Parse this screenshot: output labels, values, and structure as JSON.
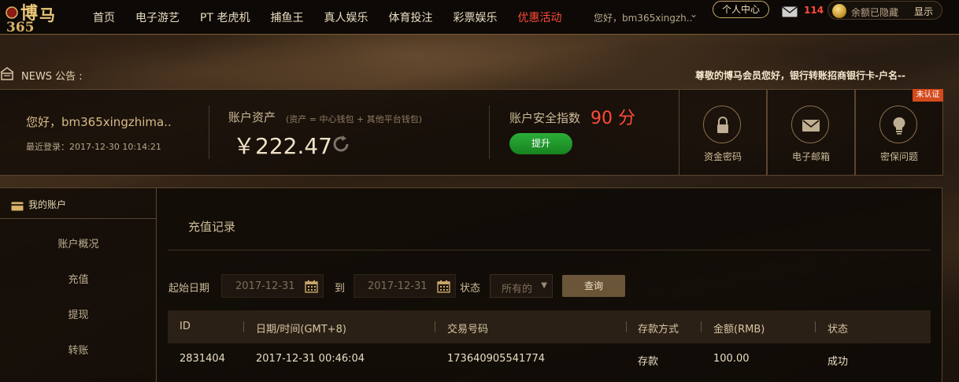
{
  "nav": {
    "items": [
      "首页",
      "电子游艺",
      "PT 老虎机",
      "捕鱼王",
      "真人娱乐",
      "体育投注",
      "彩票娱乐",
      "优惠活动"
    ],
    "highlight_index": 7,
    "greeting": "您好，bm365xingzh..",
    "user_center": "个人中心",
    "mail_count": "114",
    "balance_hidden": "余额已隐藏",
    "show": "显示"
  },
  "news": {
    "label": "NEWS 公告 :",
    "text": "尊敬的博马会员您好，银行转账招商银行卡-户名--"
  },
  "account": {
    "hello": "您好，bm365xingzhima..",
    "last_login": "最近登录：2017-12-30 10:14:21",
    "assets_label": "账户资产",
    "assets_note": "(资产 = 中心钱包 + 其他平台钱包)",
    "amount": "￥222.47",
    "security_label": "账户安全指数",
    "security_score": "90 分",
    "upgrade": "提升"
  },
  "security_tiles": [
    {
      "label": "资金密码",
      "icon": "lock-icon"
    },
    {
      "label": "电子邮箱",
      "icon": "envelope-icon"
    },
    {
      "label": "密保问题",
      "icon": "lightbulb-icon"
    }
  ],
  "badge": "未认证",
  "sidebar": {
    "title": "我的账户",
    "items": [
      "账户概况",
      "充值",
      "提现",
      "转账"
    ]
  },
  "main": {
    "title": "充值记录",
    "filters": {
      "start_label": "起始日期",
      "start_value": "2017-12-31",
      "to_label": "到",
      "end_value": "2017-12-31",
      "status_label": "状态",
      "status_value": "所有的",
      "query": "查询"
    },
    "table": {
      "headers": [
        "ID",
        "日期/时间(GMT+8)",
        "交易号码",
        "存款方式",
        "金额(RMB)",
        "状态"
      ],
      "rows": [
        [
          "2831404",
          "2017-12-31 00:46:04",
          "173640905541774",
          "存款",
          "100.00",
          "成功"
        ]
      ]
    }
  },
  "colors": {
    "accent_red": "#ff4a3a",
    "gold_border": "#c9a76b",
    "upgrade_green": "#1f9a2c",
    "badge_orange": "#d44a1c"
  }
}
